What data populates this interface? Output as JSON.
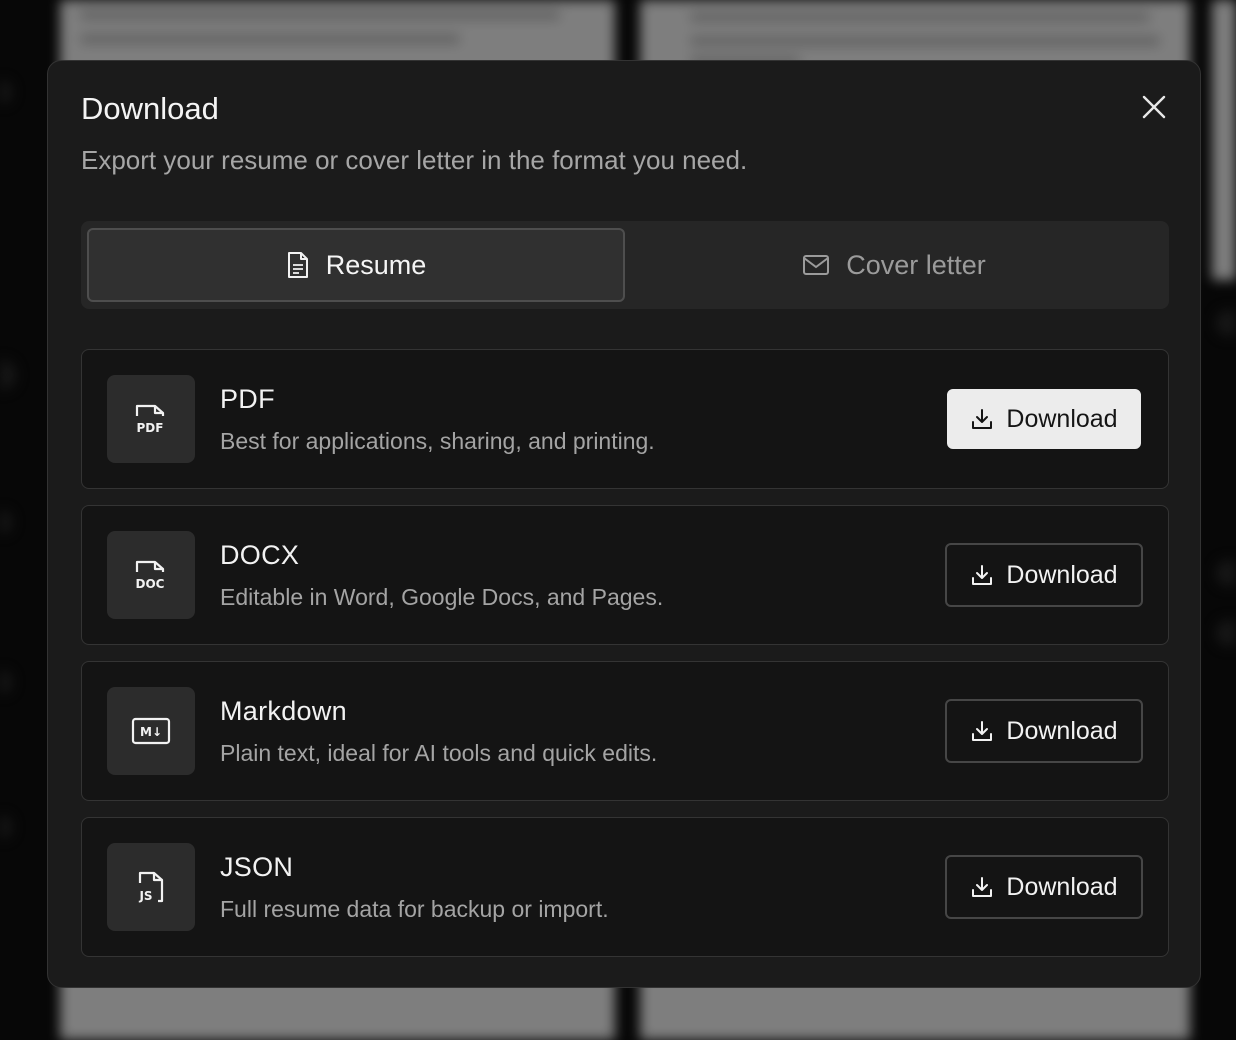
{
  "modal": {
    "title": "Download",
    "subtitle": "Export your resume or cover letter in the format you need.",
    "close_icon": "close-icon"
  },
  "tabs": [
    {
      "label": "Resume",
      "icon": "document-icon",
      "active": true
    },
    {
      "label": "Cover letter",
      "icon": "mail-icon",
      "active": false
    }
  ],
  "formats": [
    {
      "name": "PDF",
      "description": "Best for applications, sharing, and printing.",
      "icon": "pdf-file-icon",
      "icon_text": "PDF",
      "button_label": "Download",
      "primary": true
    },
    {
      "name": "DOCX",
      "description": "Editable in Word, Google Docs, and Pages.",
      "icon": "doc-file-icon",
      "icon_text": "DOC",
      "button_label": "Download",
      "primary": false
    },
    {
      "name": "Markdown",
      "description": "Plain text, ideal for AI tools and quick edits.",
      "icon": "markdown-icon",
      "icon_text": "M↓",
      "button_label": "Download",
      "primary": false
    },
    {
      "name": "JSON",
      "description": "Full resume data for backup or import.",
      "icon": "js-file-icon",
      "icon_text": "JS",
      "button_label": "Download",
      "primary": false
    }
  ],
  "colors": {
    "modal_bg": "#1b1b1b",
    "primary_button_bg": "#ececec",
    "muted_text": "#a4a4a4"
  }
}
